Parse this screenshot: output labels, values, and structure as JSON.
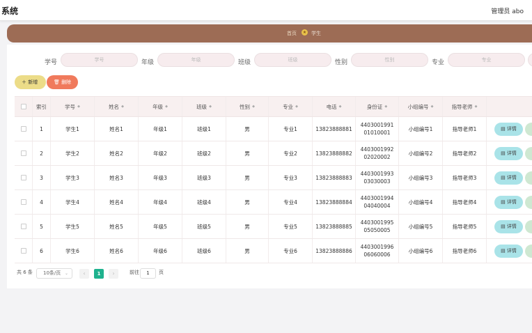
{
  "header": {
    "title": "系统",
    "user": "管理员 abo"
  },
  "breadcrumb": {
    "home": "首页",
    "current": "学生"
  },
  "search": {
    "fields": [
      {
        "label": "学号",
        "placeholder": "学号"
      },
      {
        "label": "年级",
        "placeholder": "年级"
      },
      {
        "label": "班级",
        "placeholder": "班级"
      },
      {
        "label": "性别",
        "placeholder": "性别"
      },
      {
        "label": "专业",
        "placeholder": "专业"
      }
    ]
  },
  "toolbar": {
    "add_label": "新增",
    "delete_label": "删除"
  },
  "table": {
    "headers": [
      "索引",
      "学号",
      "姓名",
      "年级",
      "班级",
      "性别",
      "专业",
      "电话",
      "身份证",
      "小组编号",
      "指导老师"
    ],
    "rows": [
      [
        "1",
        "学生1",
        "姓名1",
        "年级1",
        "班级1",
        "男",
        "专业1",
        "13823888881",
        "440300199101010001",
        "小组编号1",
        "指导老师1"
      ],
      [
        "2",
        "学生2",
        "姓名2",
        "年级2",
        "班级2",
        "男",
        "专业2",
        "13823888882",
        "440300199202020002",
        "小组编号2",
        "指导老师2"
      ],
      [
        "3",
        "学生3",
        "姓名3",
        "年级3",
        "班级3",
        "男",
        "专业3",
        "13823888883",
        "440300199303030003",
        "小组编号3",
        "指导老师3"
      ],
      [
        "4",
        "学生4",
        "姓名4",
        "年级4",
        "班级4",
        "男",
        "专业4",
        "13823888884",
        "440300199404040004",
        "小组编号4",
        "指导老师4"
      ],
      [
        "5",
        "学生5",
        "姓名5",
        "年级5",
        "班级5",
        "男",
        "专业5",
        "13823888885",
        "440300199505050005",
        "小组编号5",
        "指导老师5"
      ],
      [
        "6",
        "学生6",
        "姓名6",
        "年级6",
        "班级6",
        "男",
        "专业6",
        "13823888886",
        "440300199606060006",
        "小组编号6",
        "指导老师6"
      ]
    ],
    "detail_label": "详情"
  },
  "pagination": {
    "total": "共 6 条",
    "page_size": "10条/页",
    "current_page": "1",
    "goto_prefix": "前往",
    "goto_value": "1",
    "goto_suffix": "页"
  }
}
